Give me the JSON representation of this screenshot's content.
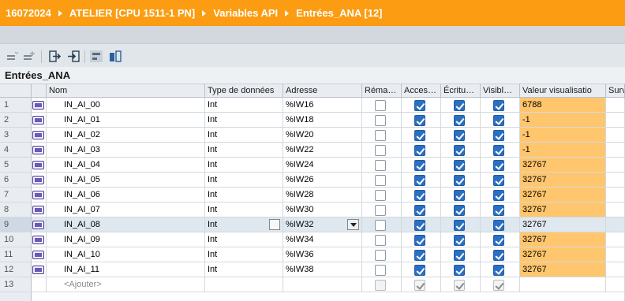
{
  "breadcrumb": {
    "items": [
      "16072024",
      "ATELIER [CPU 1511-1 PN]",
      "Variables API",
      "Entrées_ANA [12]"
    ]
  },
  "toolbar": {
    "icons": [
      "insert-row-icon",
      "add-row-icon",
      "export-icon",
      "import-icon",
      "monitor-all-icon",
      "display-format-icon"
    ]
  },
  "table": {
    "title": "Entrées_ANA",
    "headers": {
      "nom": "Nom",
      "type": "Type de données",
      "adresse": "Adresse",
      "remanence": "Réma…",
      "accessible": "Acces…",
      "ecriture": "Écritu…",
      "visible": "Visibl…",
      "valeur": "Valeur visualisatio",
      "surv": "Surv"
    },
    "rows": [
      {
        "num": "1",
        "nom": "IN_AI_00",
        "type": "Int",
        "adresse": "%IW16",
        "valeur": "6788"
      },
      {
        "num": "2",
        "nom": "IN_AI_01",
        "type": "Int",
        "adresse": "%IW18",
        "valeur": "-1"
      },
      {
        "num": "3",
        "nom": "IN_AI_02",
        "type": "Int",
        "adresse": "%IW20",
        "valeur": "-1"
      },
      {
        "num": "4",
        "nom": "IN_AI_03",
        "type": "Int",
        "adresse": "%IW22",
        "valeur": "-1"
      },
      {
        "num": "5",
        "nom": "IN_AI_04",
        "type": "Int",
        "adresse": "%IW24",
        "valeur": "32767"
      },
      {
        "num": "6",
        "nom": "IN_AI_05",
        "type": "Int",
        "adresse": "%IW26",
        "valeur": "32767"
      },
      {
        "num": "7",
        "nom": "IN_AI_06",
        "type": "Int",
        "adresse": "%IW28",
        "valeur": "32767"
      },
      {
        "num": "8",
        "nom": "IN_AI_07",
        "type": "Int",
        "adresse": "%IW30",
        "valeur": "32767"
      },
      {
        "num": "9",
        "nom": "IN_AI_08",
        "type": "Int",
        "adresse": "%IW32",
        "valeur": "32767"
      },
      {
        "num": "10",
        "nom": "IN_AI_09",
        "type": "Int",
        "adresse": "%IW34",
        "valeur": "32767"
      },
      {
        "num": "11",
        "nom": "IN_AI_10",
        "type": "Int",
        "adresse": "%IW36",
        "valeur": "32767"
      },
      {
        "num": "12",
        "nom": "IN_AI_11",
        "type": "Int",
        "adresse": "%IW38",
        "valeur": "32767"
      }
    ],
    "add_row": {
      "num": "13",
      "label": "<Ajouter>"
    },
    "selected_row": "9",
    "colors": {
      "accent": "#fb9c12",
      "value_highlight": "#ffc66d",
      "checkbox_on": "#2b6fc2"
    }
  }
}
